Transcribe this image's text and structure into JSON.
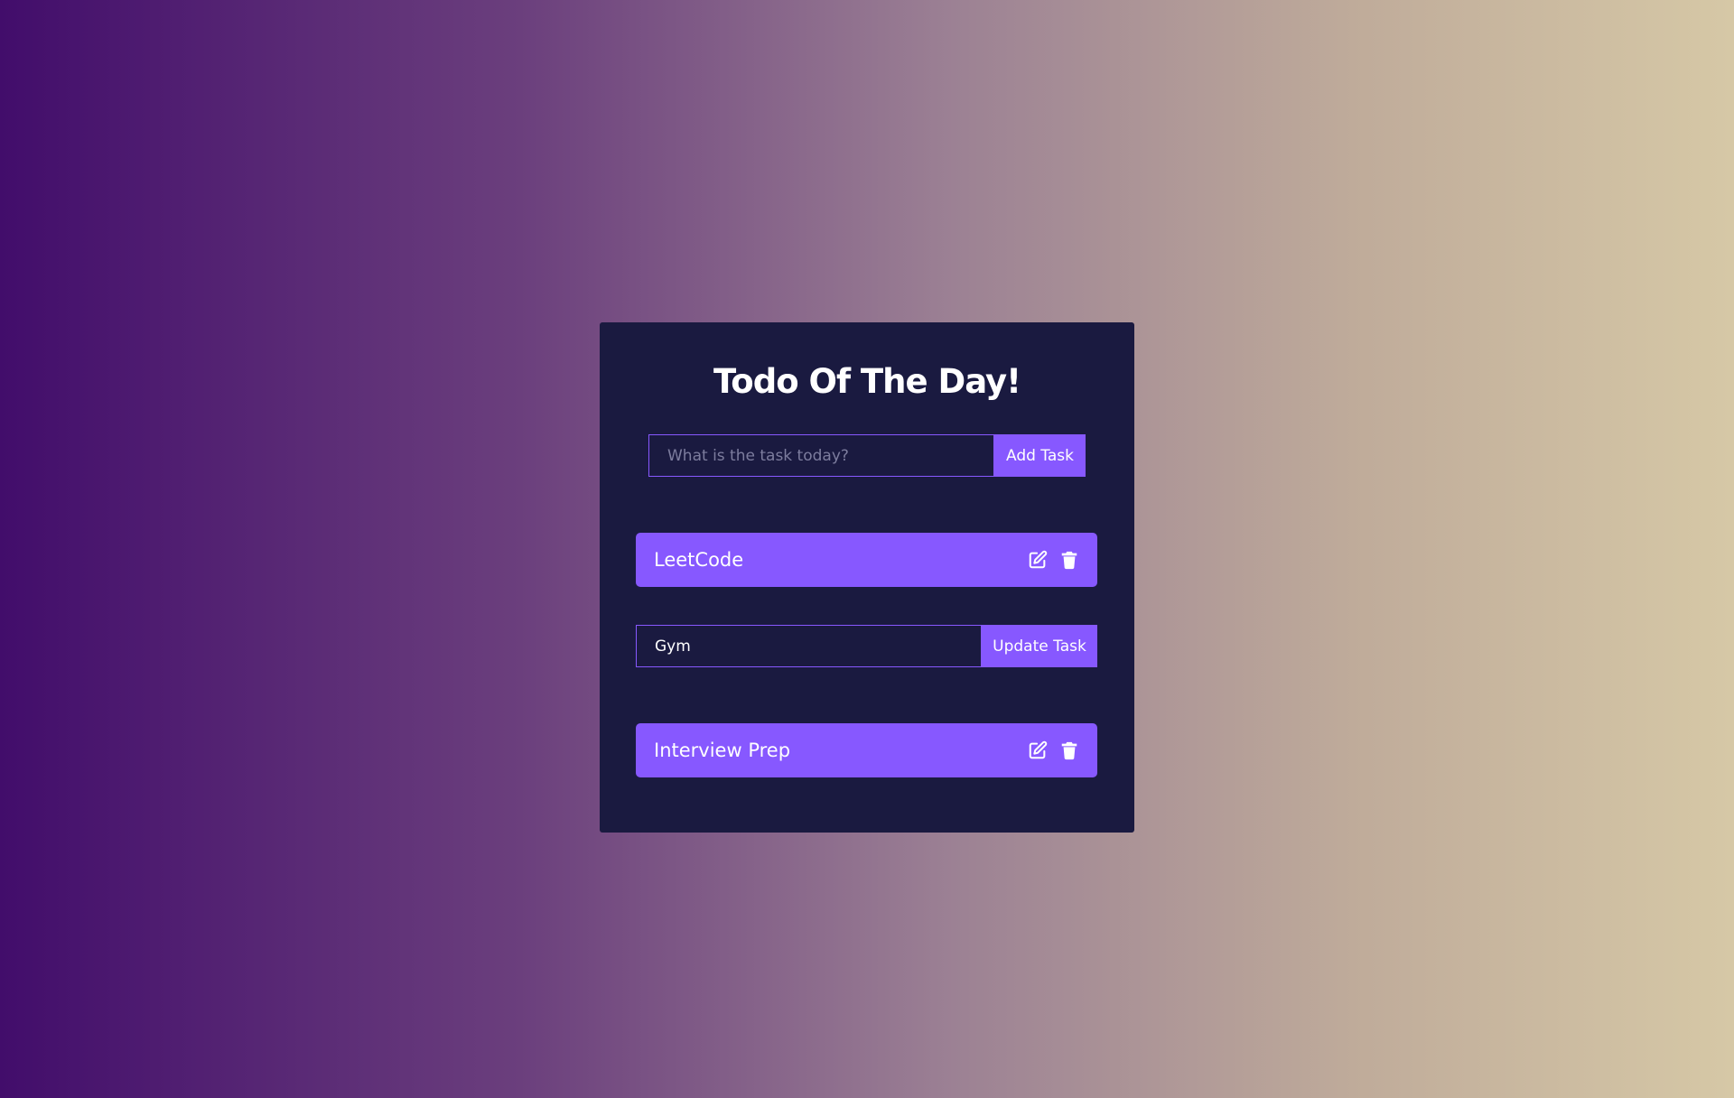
{
  "app": {
    "title": "Todo Of The Day!"
  },
  "add_form": {
    "placeholder": "What is the task today?",
    "value": "",
    "button_label": "Add Task"
  },
  "todos": [
    {
      "label": "LeetCode",
      "editing": false
    },
    {
      "label": "Gym",
      "editing": true
    },
    {
      "label": "Interview Prep",
      "editing": false
    }
  ],
  "edit_form": {
    "value": "Gym",
    "button_label": "Update Task"
  },
  "icons": {
    "edit": "edit-icon",
    "delete": "trash-icon"
  },
  "colors": {
    "card_bg": "#1a1a40",
    "accent": "#8758ff",
    "text": "#ffffff"
  }
}
